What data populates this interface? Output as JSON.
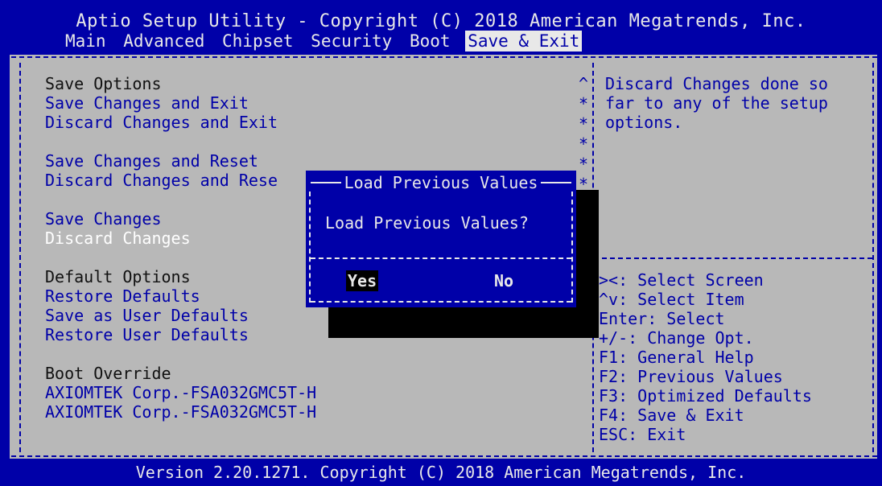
{
  "header": {
    "title": "Aptio Setup Utility - Copyright (C) 2018 American Megatrends, Inc."
  },
  "tabs": [
    {
      "label": "Main"
    },
    {
      "label": "Advanced"
    },
    {
      "label": "Chipset"
    },
    {
      "label": "Security"
    },
    {
      "label": "Boot"
    },
    {
      "label": "Save & Exit",
      "active": true
    }
  ],
  "menu": {
    "save_options_head": "Save Options",
    "save_changes_and_exit": "Save Changes and Exit",
    "discard_changes_and_exit": "Discard Changes and Exit",
    "save_changes_and_reset": "Save Changes and Reset",
    "discard_changes_and_reset": "Discard Changes and Rese",
    "save_changes": "Save Changes",
    "discard_changes": "Discard Changes",
    "default_options_head": "Default Options",
    "restore_defaults": "Restore Defaults",
    "save_as_user_defaults": "Save as User Defaults",
    "restore_user_defaults": "Restore User Defaults",
    "boot_override_head": "Boot Override",
    "boot_device_1": "AXIOMTEK Corp.-FSA032GMC5T-H",
    "boot_device_2": "AXIOMTEK Corp.-FSA032GMC5T-H"
  },
  "help": {
    "line1": "Discard Changes done so",
    "line2": "far to any of the setup",
    "line3": "options."
  },
  "keys": [
    "><: Select Screen",
    "^v: Select Item",
    "Enter: Select",
    "+/-: Change Opt.",
    "F1: General Help",
    "F2: Previous Values",
    "F3: Optimized Defaults",
    "F4: Save & Exit",
    "ESC: Exit"
  ],
  "dialog": {
    "title": "Load Previous Values",
    "message": "Load Previous Values?",
    "yes_label": "Yes",
    "no_label": "No"
  },
  "footer": {
    "text": "Version 2.20.1271. Copyright (C) 2018 American Megatrends, Inc."
  },
  "colors": {
    "bios_blue": "#0000a8",
    "panel_gray": "#b8b8b8",
    "text_white": "#e8e8e8",
    "selected_white": "#ffffff"
  }
}
